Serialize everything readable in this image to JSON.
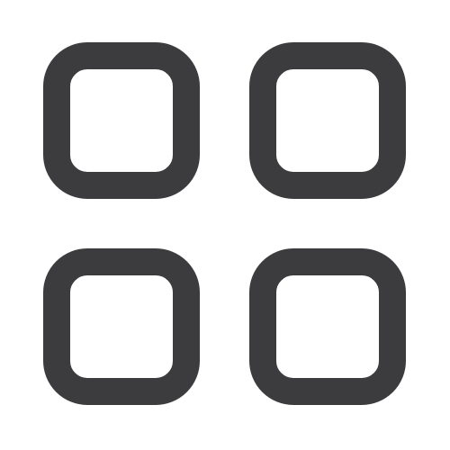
{
  "icon": {
    "name": "grid-view-icon",
    "stroke_color": "#3c3c3e",
    "background_color": "#ffffff",
    "tiles": [
      {
        "name": "grid-tile-top-left"
      },
      {
        "name": "grid-tile-top-right"
      },
      {
        "name": "grid-tile-bottom-left"
      },
      {
        "name": "grid-tile-bottom-right"
      }
    ]
  }
}
